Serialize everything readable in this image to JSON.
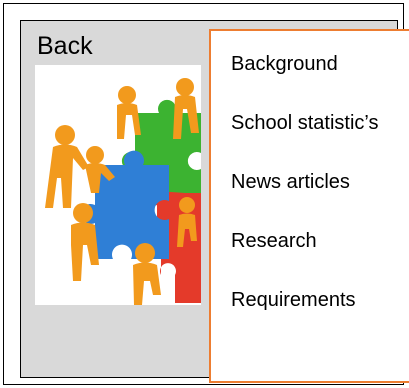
{
  "back_label": "Back",
  "menu": {
    "items": [
      {
        "label": "Background"
      },
      {
        "label": "School statistic’s"
      },
      {
        "label": "News articles"
      },
      {
        "label": "Research"
      },
      {
        "label": "Requirements"
      }
    ]
  },
  "colors": {
    "menu_border": "#ed7d31",
    "panel_bg": "#d9d9d9",
    "figure_orange": "#f29a1d",
    "puzzle_green": "#3cb331",
    "puzzle_blue": "#2f7fd6",
    "puzzle_red": "#e43a2a"
  },
  "image": {
    "icon": "teamwork-puzzle-illustration"
  }
}
